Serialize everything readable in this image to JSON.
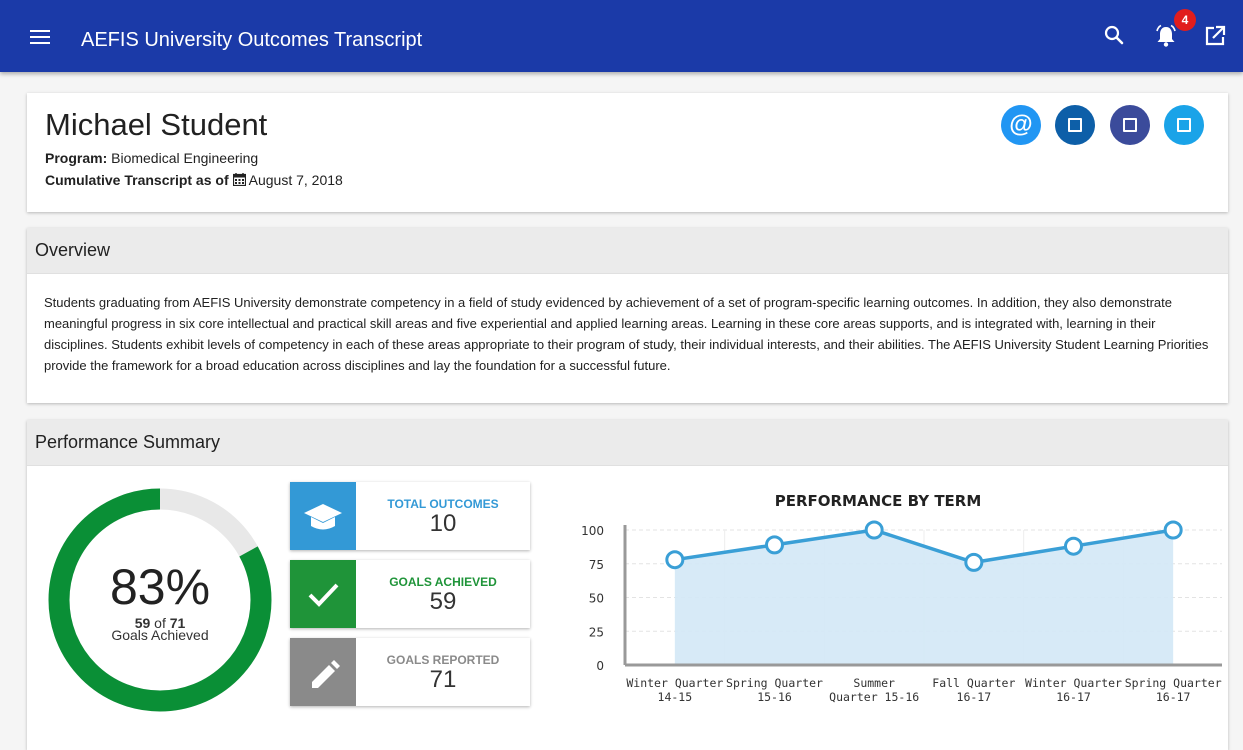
{
  "app": {
    "title": "AEFIS University Outcomes Transcript",
    "notification_count": "4"
  },
  "icons": {
    "menu": "menu-icon",
    "search": "search-icon",
    "notifications": "bell-icon",
    "open": "open-in-new-icon",
    "calendar": "calendar-icon"
  },
  "student": {
    "name": "Michael Student",
    "program_label": "Program:",
    "program": "Biomedical Engineering",
    "transcript_label": "Cumulative Transcript as of",
    "transcript_date": "August 7, 2018",
    "contact_buttons": [
      {
        "glyph": "@",
        "color": "#2196f3",
        "icon": "at-sign-icon"
      },
      {
        "color": "#0d5fa8",
        "icon": "square-icon"
      },
      {
        "color": "#3b4b9b",
        "icon": "square-icon"
      },
      {
        "color": "#1aa3e8",
        "icon": "square-icon"
      }
    ]
  },
  "overview": {
    "title": "Overview",
    "text": "Students graduating from AEFIS University demonstrate competency in a field of study evidenced by achievement of a set of program-specific learning outcomes. In addition, they also demonstrate meaningful progress in six core intellectual and practical skill areas and five experiential and applied learning areas. Learning in these core areas supports, and is integrated with, learning in their disciplines. Students exhibit levels of competency in each of these areas appropriate to their program of study, their individual interests, and their abilities. The AEFIS University Student Learning Priorities provide the framework for a broad education across disciplines and lay the foundation for a successful future."
  },
  "performance": {
    "title": "Performance Summary",
    "percent": "83%",
    "achieved": "59",
    "of_label": "of",
    "total": "71",
    "achieved_label": "Goals Achieved",
    "achieved_fraction": 0.83,
    "colors": {
      "ring": "#0a8f36",
      "track": "#e8e8e8"
    },
    "stats": [
      {
        "label": "TOTAL OUTCOMES",
        "value": "10",
        "color": "#3399d6",
        "icon": "graduation-cap-icon"
      },
      {
        "label": "GOALS ACHIEVED",
        "value": "59",
        "color": "#1f9439",
        "icon": "checkmark-icon"
      },
      {
        "label": "GOALS REPORTED",
        "value": "71",
        "color": "#8a8a8a",
        "icon": "pencil-icon"
      }
    ]
  },
  "chart_data": {
    "type": "area",
    "title": "PERFORMANCE BY TERM",
    "categories": [
      [
        "Winter Quarter",
        "14-15"
      ],
      [
        "Spring Quarter",
        "15-16"
      ],
      [
        "Summer",
        "Quarter 15-16"
      ],
      [
        "Fall Quarter",
        "16-17"
      ],
      [
        "Winter Quarter",
        "16-17"
      ],
      [
        "Spring Quarter",
        "16-17"
      ]
    ],
    "values": [
      78,
      89,
      100,
      76,
      88,
      100
    ],
    "ylim": [
      0,
      100
    ],
    "yticks": [
      0,
      25,
      50,
      75,
      100
    ],
    "grid": true,
    "colors": {
      "line": "#3a9fd6",
      "fill": "#d3e8f6"
    }
  }
}
